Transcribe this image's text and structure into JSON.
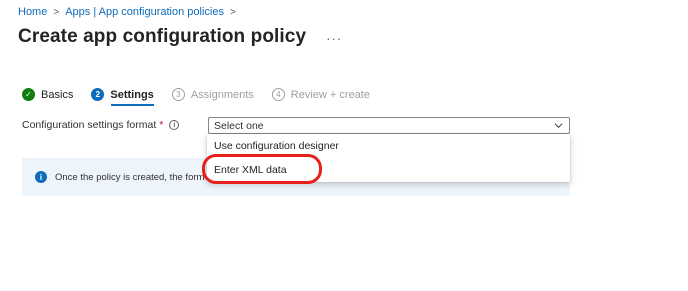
{
  "breadcrumb": {
    "home": "Home",
    "apps": "Apps | App configuration policies",
    "separator": ">"
  },
  "page": {
    "title": "Create app configuration policy",
    "more": "···"
  },
  "steps": [
    {
      "num": "✓",
      "label": "Basics",
      "state": "done"
    },
    {
      "num": "2",
      "label": "Settings",
      "state": "active"
    },
    {
      "num": "3",
      "label": "Assignments",
      "state": "todo"
    },
    {
      "num": "4",
      "label": "Review + create",
      "state": "todo"
    }
  ],
  "form": {
    "field_label": "Configuration settings format",
    "required_mark": "*",
    "info_glyph": "i",
    "select_value": "Select one",
    "options": [
      "Use configuration designer",
      "Enter XML data"
    ]
  },
  "info_bar": {
    "text": "Once the policy is created, the format c"
  },
  "colors": {
    "accent": "#0f6cbd",
    "success": "#107c10",
    "highlight": "#e8201b"
  },
  "icons": {
    "chevron": "chevron-down-icon",
    "info": "info-icon",
    "check": "check-icon"
  }
}
